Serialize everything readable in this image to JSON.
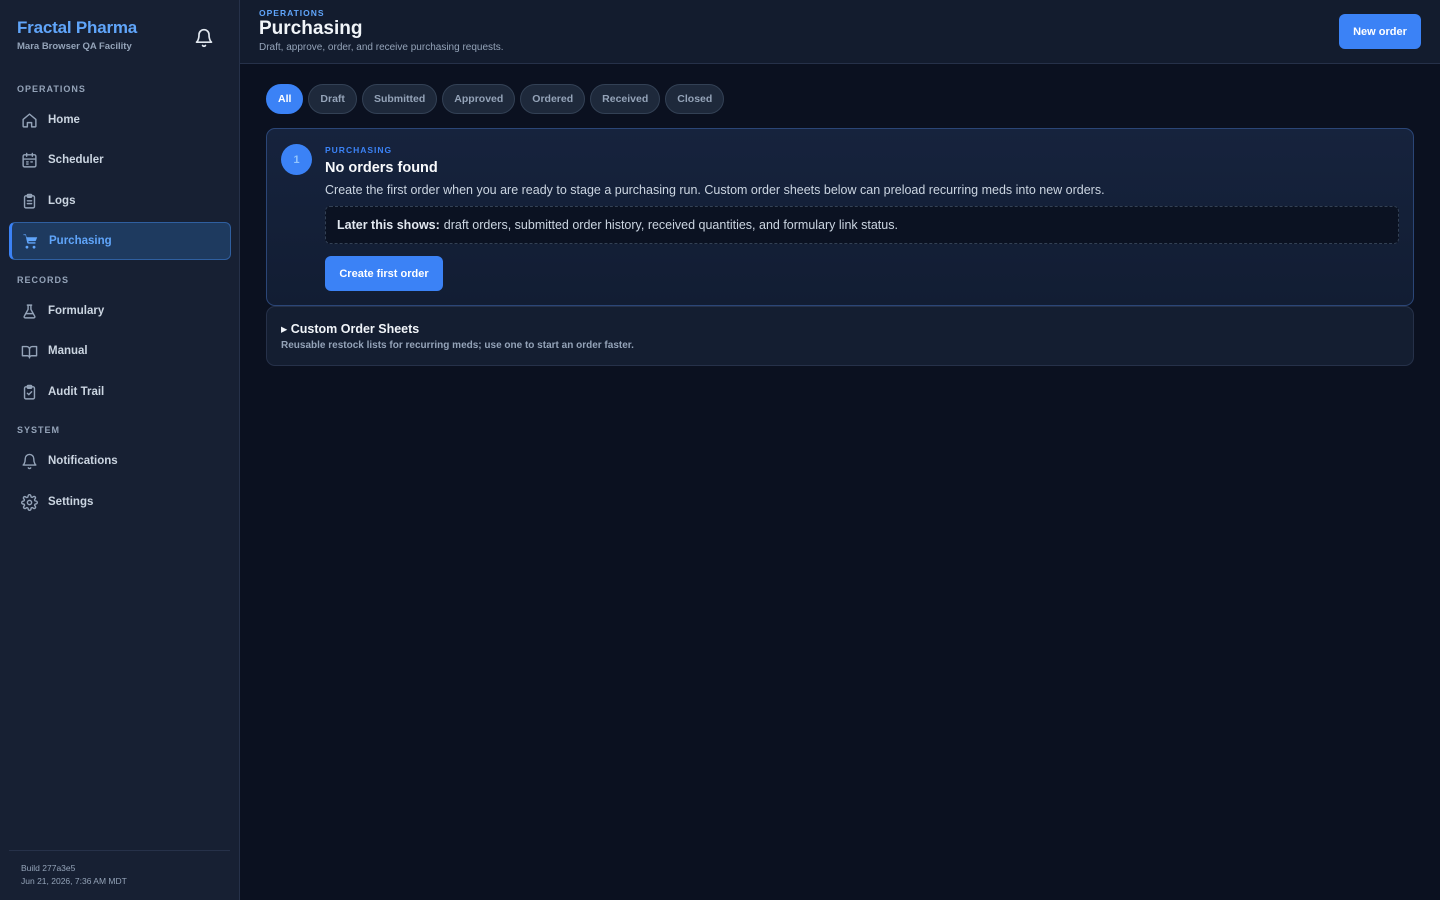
{
  "brand": {
    "name": "Fractal Pharma",
    "facility": "Mara Browser QA Facility"
  },
  "sidebar": {
    "sections": [
      {
        "label": "OPERATIONS"
      },
      {
        "label": "RECORDS"
      },
      {
        "label": "SYSTEM"
      }
    ],
    "items": [
      {
        "label": "Home",
        "icon": "home-icon"
      },
      {
        "label": "Scheduler",
        "icon": "calendar-icon"
      },
      {
        "label": "Logs",
        "icon": "clipboard-icon"
      },
      {
        "label": "Purchasing",
        "icon": "cart-icon",
        "active": true
      },
      {
        "label": "Formulary",
        "icon": "flask-icon"
      },
      {
        "label": "Manual",
        "icon": "book-icon"
      },
      {
        "label": "Audit Trail",
        "icon": "clipboard-check-icon"
      },
      {
        "label": "Notifications",
        "icon": "bell-icon"
      },
      {
        "label": "Settings",
        "icon": "gear-icon"
      }
    ],
    "footer": {
      "build": "Build 277a3e5",
      "timestamp": "Jun 21, 2026, 7:36 AM MDT"
    }
  },
  "header": {
    "eyebrow": "OPERATIONS",
    "title": "Purchasing",
    "subtitle": "Draft, approve, order, and receive purchasing requests.",
    "new_order_label": "New order"
  },
  "filters": [
    {
      "label": "All",
      "active": true
    },
    {
      "label": "Draft"
    },
    {
      "label": "Submitted"
    },
    {
      "label": "Approved"
    },
    {
      "label": "Ordered"
    },
    {
      "label": "Received"
    },
    {
      "label": "Closed"
    }
  ],
  "empty_state": {
    "step": "1",
    "eyebrow": "PURCHASING",
    "title": "No orders found",
    "description": "Create the first order when you are ready to stage a purchasing run. Custom order sheets below can preload recurring meds into new orders.",
    "later_label": "Later this shows:",
    "later_text": "draft orders, submitted order history, received quantities, and formulary link status.",
    "cta_label": "Create first order"
  },
  "custom_sheets": {
    "title": "▸ Custom Order Sheets",
    "subtitle": "Reusable restock lists for recurring meds; use one to start an order faster."
  },
  "colors": {
    "accent": "#3b82f6",
    "brand": "#60a5fa",
    "background": "#0b1120",
    "sidebar": "#172033"
  }
}
